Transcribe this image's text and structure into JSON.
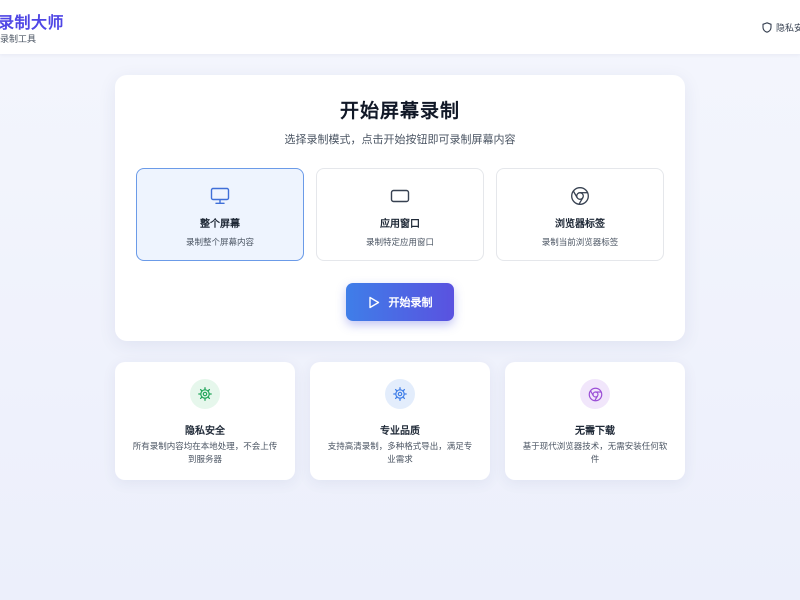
{
  "header": {
    "app_title": "录制大师",
    "app_subtitle": "录制工具",
    "privacy_label": "隐私安"
  },
  "main": {
    "title": "开始屏幕录制",
    "subtitle": "选择录制模式，点击开始按钮即可录制屏幕内容",
    "modes": [
      {
        "label": "整个屏幕",
        "desc": "录制整个屏幕内容",
        "icon": "monitor-icon",
        "selected": true
      },
      {
        "label": "应用窗口",
        "desc": "录制特定应用窗口",
        "icon": "window-icon",
        "selected": false
      },
      {
        "label": "浏览器标签",
        "desc": "录制当前浏览器标签",
        "icon": "chrome-icon",
        "selected": false
      }
    ],
    "start_label": "开始录制"
  },
  "features": [
    {
      "title": "隐私安全",
      "desc": "所有录制内容均在本地处理，不会上传到服务器",
      "icon": "gear-icon",
      "color": "#22a55a",
      "bg": "#e6f7ec"
    },
    {
      "title": "专业品质",
      "desc": "支持高清录制，多种格式导出，满足专业需求",
      "icon": "gear-icon",
      "color": "#3f7ee8",
      "bg": "#e3edfc"
    },
    {
      "title": "无需下载",
      "desc": "基于现代浏览器技术，无需安装任何软件",
      "icon": "chrome-icon",
      "color": "#9b4fd6",
      "bg": "#f1e6fb"
    }
  ],
  "colors": {
    "accent_start": "#3f7ee8",
    "accent_end": "#5a52e0",
    "brand": "#4f46e5",
    "selected_border": "#6b9be8"
  }
}
